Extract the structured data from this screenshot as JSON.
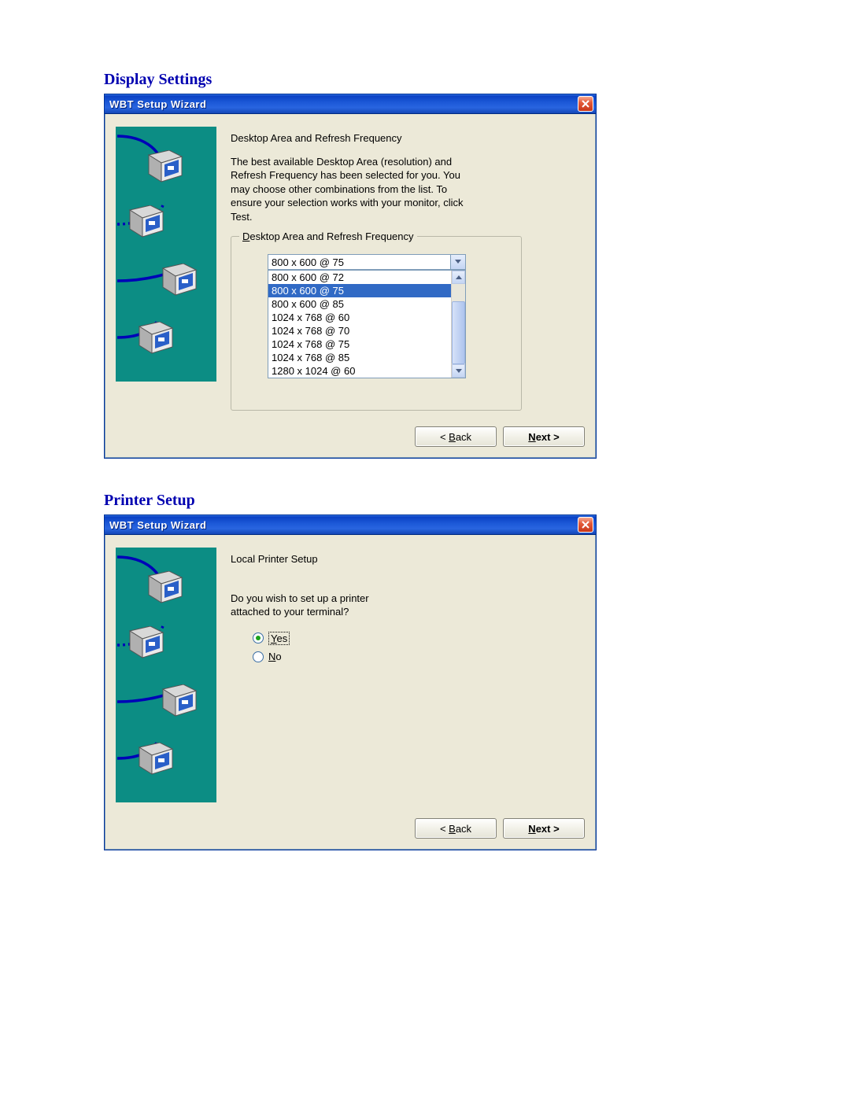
{
  "section1": {
    "heading": "Display Settings",
    "window_title": "WBT Setup Wizard",
    "content_heading": "Desktop Area and Refresh Frequency",
    "content_body": "The best available Desktop Area (resolution) and Refresh Frequency has been selected for you.  You may choose other combinations from the list.  To ensure your selection works with your monitor, click Test.",
    "groupbox_label": "Desktop Area and Refresh Frequency",
    "combo_selected": "800 x 600 @ 75",
    "combo_options": [
      "800 x 600 @ 72",
      "800 x 600 @ 75",
      "800 x 600 @ 85",
      "1024 x 768 @ 60",
      "1024 x 768 @ 70",
      "1024 x 768 @ 75",
      "1024 x 768 @ 85",
      "1280 x 1024 @ 60"
    ],
    "combo_highlight_index": 1,
    "back_label": "Back",
    "next_label": "Next >"
  },
  "section2": {
    "heading": "Printer Setup",
    "window_title": "WBT Setup Wizard",
    "content_heading": "Local Printer Setup",
    "content_body": "Do you wish to set up a printer attached to your terminal?",
    "radio_yes": "Yes",
    "radio_no": "No",
    "back_label": "Back",
    "next_label": "Next >"
  }
}
